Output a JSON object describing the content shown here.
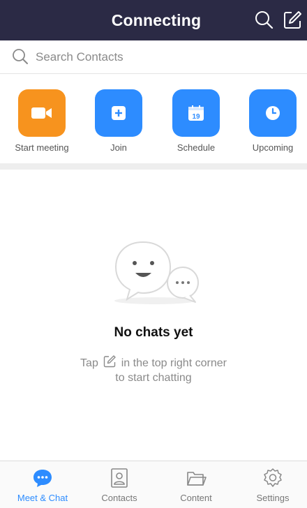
{
  "header": {
    "title": "Connecting"
  },
  "search": {
    "placeholder": "Search Contacts"
  },
  "actions": [
    {
      "label": "Start meeting",
      "icon": "video-camera-icon",
      "color": "#f7931e"
    },
    {
      "label": "Join",
      "icon": "plus-icon",
      "color": "#2d8cff"
    },
    {
      "label": "Schedule",
      "icon": "calendar-icon",
      "color": "#2d8cff",
      "calendar_day": "19"
    },
    {
      "label": "Upcoming",
      "icon": "clock-icon",
      "color": "#2d8cff"
    }
  ],
  "empty_state": {
    "title": "No chats yet",
    "hint_prefix": "Tap",
    "hint_suffix": "in the top right corner",
    "hint_line2": "to start chatting"
  },
  "bottom_nav": [
    {
      "label": "Meet & Chat",
      "icon": "chat-bubble-icon",
      "active": true
    },
    {
      "label": "Contacts",
      "icon": "contacts-icon",
      "active": false
    },
    {
      "label": "Content",
      "icon": "folder-icon",
      "active": false
    },
    {
      "label": "Settings",
      "icon": "gear-icon",
      "active": false
    }
  ],
  "colors": {
    "header_bg": "#2b2a45",
    "accent_blue": "#2d8cff",
    "accent_orange": "#f7931e"
  }
}
